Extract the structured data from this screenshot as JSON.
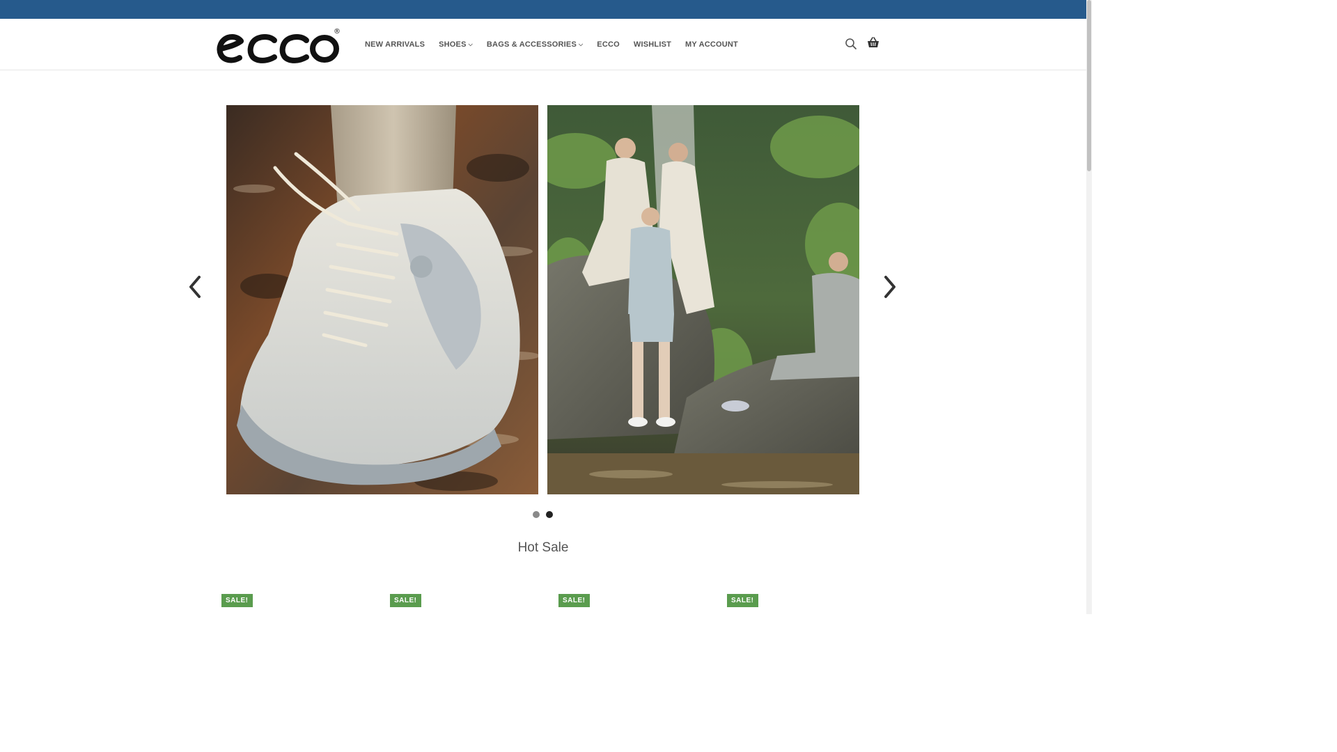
{
  "brand": {
    "name": "ecco",
    "registered_mark": "®"
  },
  "nav": {
    "items": [
      {
        "label": "NEW ARRIVALS",
        "dropdown": false
      },
      {
        "label": "SHOES",
        "dropdown": true
      },
      {
        "label": "BAGS & ACCESSORIES",
        "dropdown": true
      },
      {
        "label": "ECCO",
        "dropdown": false
      },
      {
        "label": "WISHLIST",
        "dropdown": false
      },
      {
        "label": "MY ACCOUNT",
        "dropdown": false
      }
    ],
    "chevron_glyph": "⌵"
  },
  "header_icons": [
    "search-icon",
    "basket-icon"
  ],
  "slider": {
    "slides": [
      "shoe-in-water-photo",
      "group-by-waterfall-photo"
    ],
    "dots": [
      {
        "active": false
      },
      {
        "active": true
      }
    ],
    "active_index": 1
  },
  "hot_sale": {
    "title": "Hot Sale",
    "badges": [
      "SALE!",
      "SALE!",
      "SALE!",
      "SALE!"
    ]
  },
  "colors": {
    "topbar": "#265a8c",
    "sale_badge": "#5a9c4e",
    "nav_text": "#555555"
  }
}
